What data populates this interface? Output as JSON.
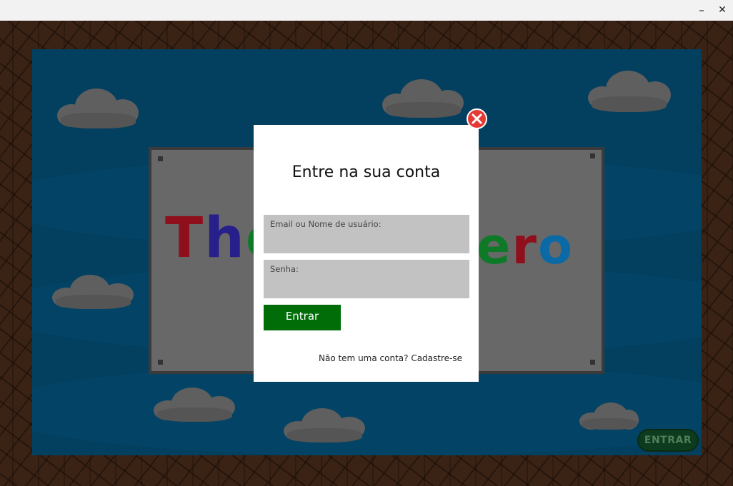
{
  "window": {
    "minimize_glyph": "–",
    "close_glyph": "✕"
  },
  "background": {
    "logo_left": [
      "T",
      "h",
      "e"
    ],
    "logo_right": [
      "e",
      "r",
      "o"
    ],
    "logo_colors": {
      "T": "#8f101c",
      "h": "#28208a",
      "e_green": "#0e7a28",
      "e_red": "#8f101c",
      "r": "#8f101c",
      "o": "#0b6aa6"
    },
    "corner_button_label": "ENTRAR"
  },
  "modal": {
    "title": "Entre na sua conta",
    "email_label": "Email ou Nome de usuário:",
    "email_value": "",
    "password_label": "Senha:",
    "password_value": "",
    "submit_label": "Entrar",
    "signup_link": "Não tem uma conta? Cadastre-se",
    "close_icon": "close-icon",
    "accent_color": "#006d09",
    "close_color": "#e53935"
  }
}
